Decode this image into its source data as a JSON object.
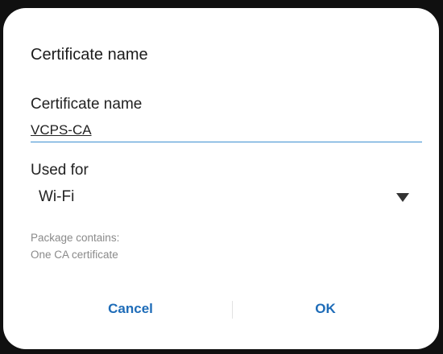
{
  "dialog": {
    "title": "Certificate name",
    "name_field": {
      "label": "Certificate name",
      "value": "VCPS-CA"
    },
    "used_for": {
      "label": "Used for",
      "selected": "Wi-Fi"
    },
    "package": {
      "label": "Package contains:",
      "value": "One CA certificate"
    },
    "buttons": {
      "cancel": "Cancel",
      "ok": "OK"
    }
  },
  "colors": {
    "accent": "#1e6cb8",
    "underline": "#3b8fd0",
    "secondary_text": "#8a8a8a"
  }
}
